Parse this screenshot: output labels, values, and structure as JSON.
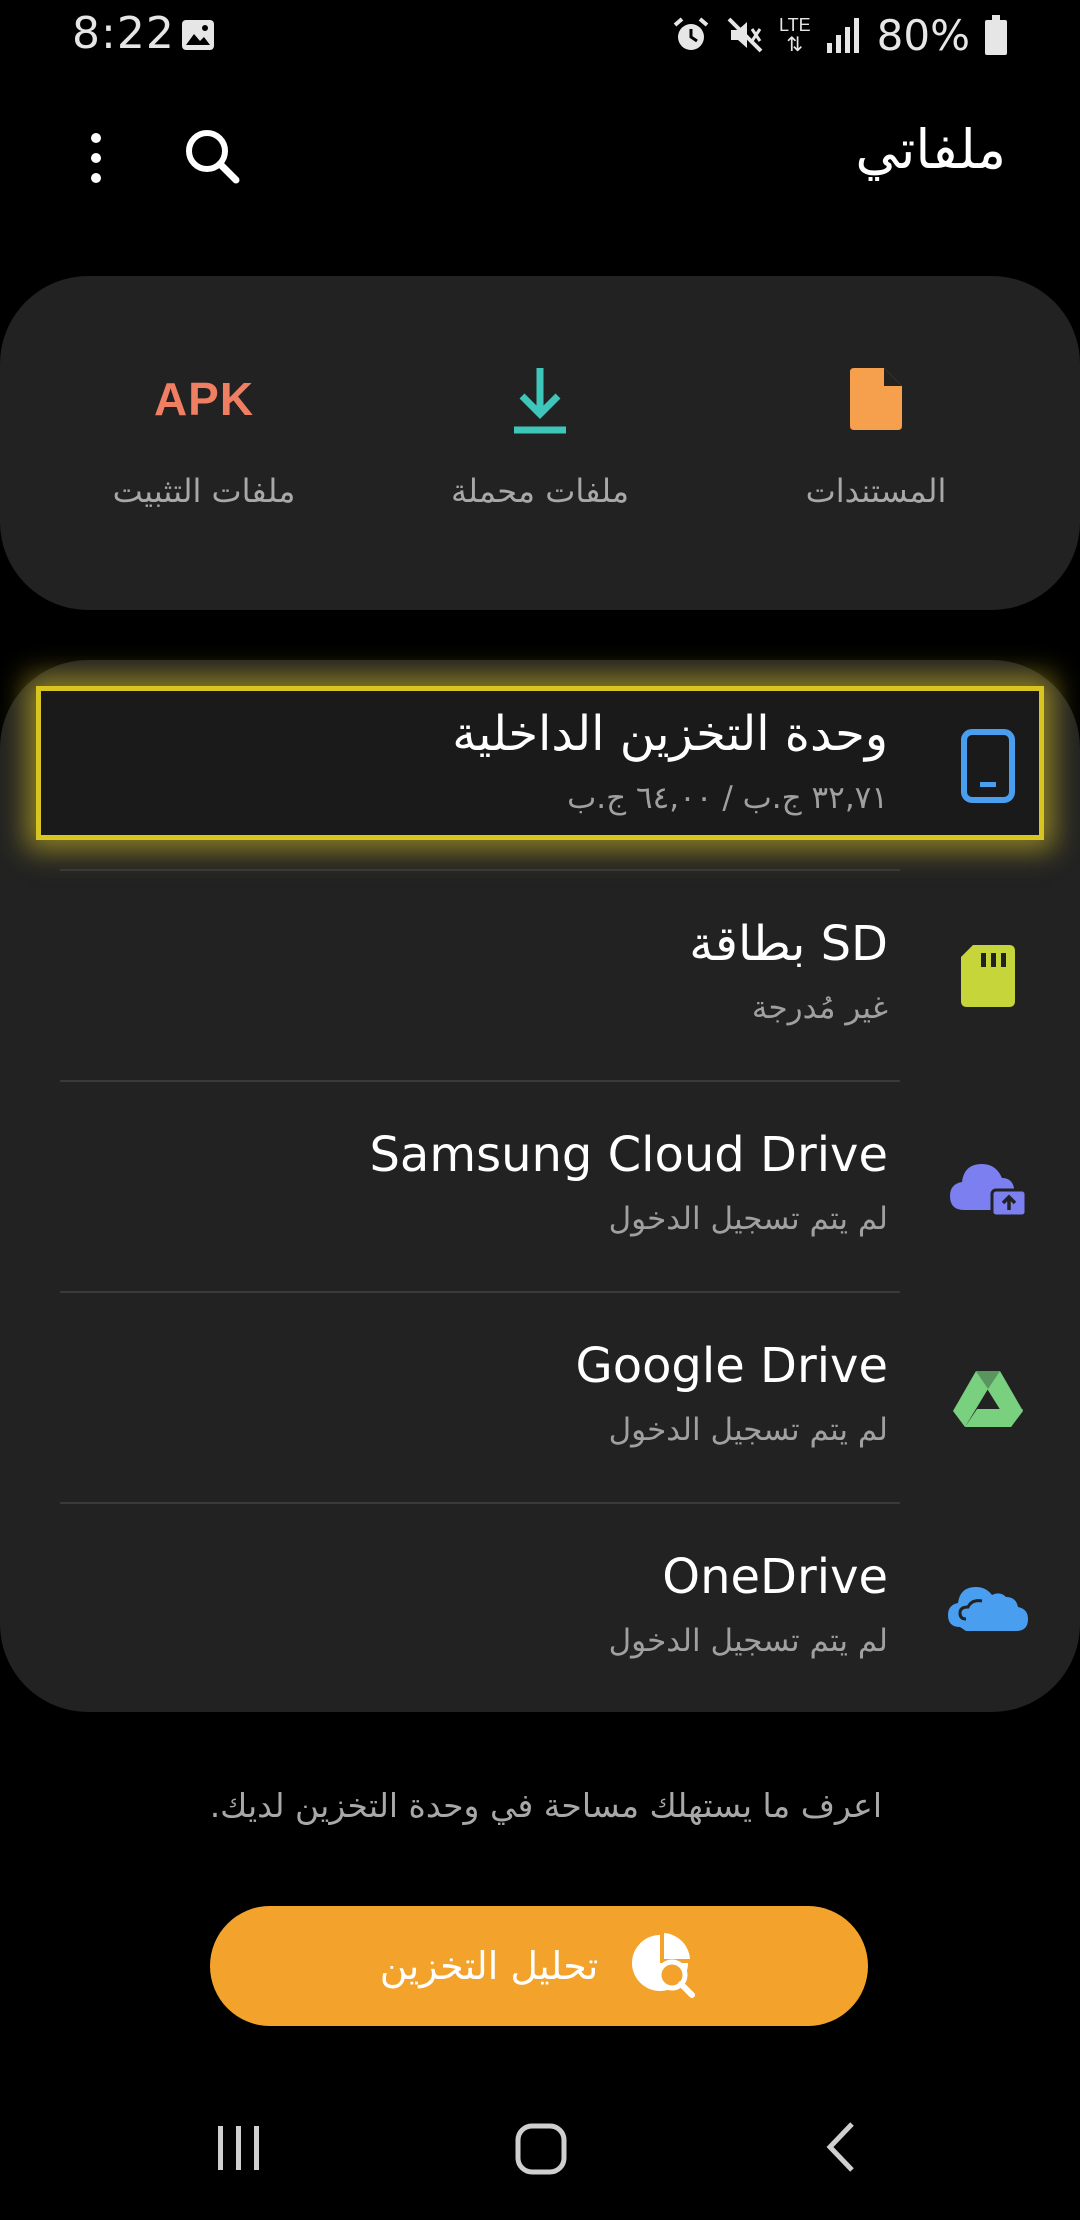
{
  "status": {
    "time": "8:22",
    "network": "LTE",
    "battery": "80%",
    "icons": [
      "gallery-icon",
      "alarm-icon",
      "mute-icon",
      "lte-icon",
      "signal-icon",
      "battery-icon"
    ]
  },
  "app_bar": {
    "title": "ملفاتي",
    "icons": [
      "search-icon",
      "more-options-icon"
    ]
  },
  "categories": [
    {
      "label": "المستندات",
      "icon": "document-icon",
      "color": "#f6a04d"
    },
    {
      "label": "ملفات محملة",
      "icon": "download-icon",
      "color": "#3ec6bb"
    },
    {
      "label": "ملفات التثبيت",
      "icon": "apk-icon",
      "icon_text": "APK",
      "color": "#f07e62"
    }
  ],
  "storage": [
    {
      "title": "وحدة التخزين الداخلية",
      "subtitle": "٣٢,٧١ ج.ب / ٦٤,٠٠ ج.ب",
      "icon": "phone-storage-icon",
      "color": "#4a9ef0",
      "highlighted": true
    },
    {
      "title": "بطاقة SD",
      "subtitle": "غير مُدرجة",
      "icon": "sd-card-icon",
      "color": "#c6d63a"
    },
    {
      "title": "Samsung Cloud Drive",
      "subtitle": "لم يتم تسجيل الدخول",
      "icon": "samsung-cloud-icon",
      "color": "#7b7ff0"
    },
    {
      "title": "Google Drive",
      "subtitle": "لم يتم تسجيل الدخول",
      "icon": "google-drive-icon",
      "color": "#79d17f"
    },
    {
      "title": "OneDrive",
      "subtitle": "لم يتم تسجيل الدخول",
      "icon": "onedrive-icon",
      "color": "#4a9ef0"
    }
  ],
  "footer": {
    "hint": "اعرف ما يستهلك مساحة في وحدة التخزين لديك.",
    "analyze_label": "تحليل التخزين",
    "analyze_icon": "storage-analysis-icon",
    "accent": "#f3a22b"
  },
  "nav": [
    "recent-apps-icon",
    "home-icon",
    "back-icon"
  ]
}
